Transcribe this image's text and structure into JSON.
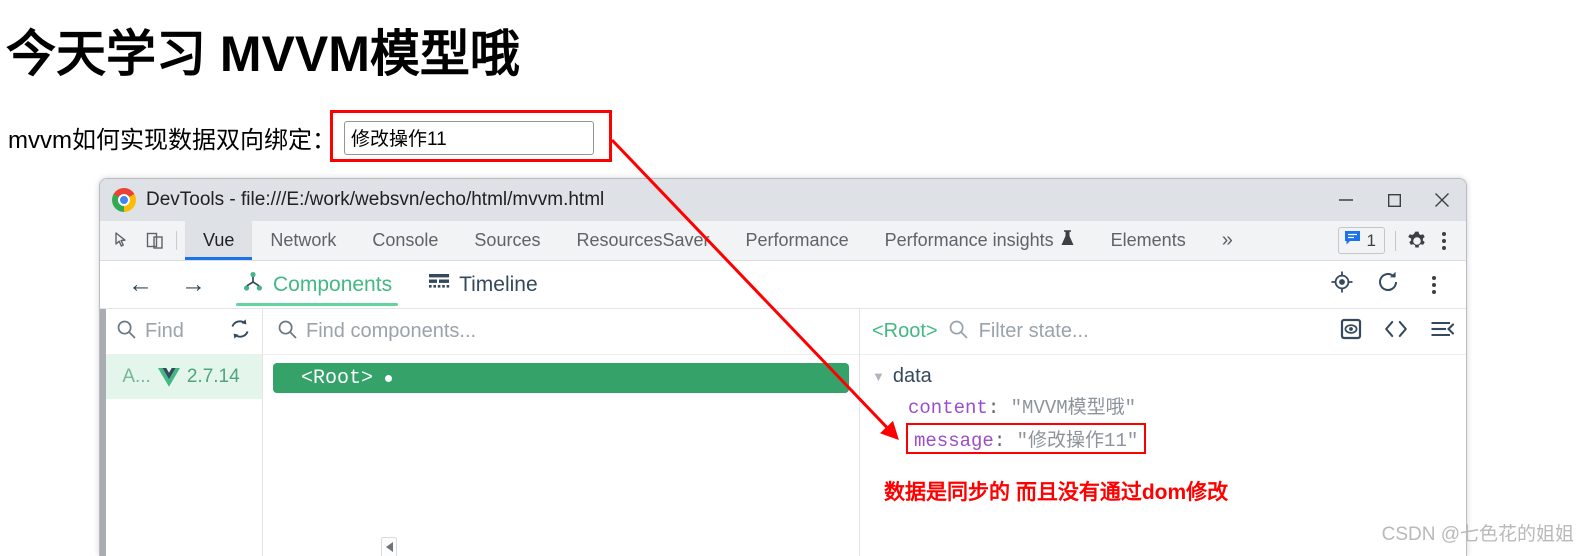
{
  "page": {
    "heading": "今天学习 MVVM模型哦",
    "binding_label": "mvvm如何实现数据双向绑定：",
    "input_value": "修改操作11",
    "input_placeholder": ""
  },
  "window": {
    "title": "DevTools - file:///E:/work/websvn/echo/html/mvvm.html",
    "minimize_label": "—",
    "maximize_label": "□",
    "close_label": "✕"
  },
  "devtools_tabs": {
    "items": [
      {
        "label": "Vue",
        "active": true
      },
      {
        "label": "Network",
        "active": false
      },
      {
        "label": "Console",
        "active": false
      },
      {
        "label": "Sources",
        "active": false
      },
      {
        "label": "ResourcesSaver",
        "active": false
      },
      {
        "label": "Performance",
        "active": false
      },
      {
        "label": "Performance insights",
        "active": false
      },
      {
        "label": "Elements",
        "active": false
      }
    ],
    "overflow_label": "»",
    "message_count": "1",
    "icons": {
      "inspect": "inspect-element-icon",
      "device": "device-toolbar-icon",
      "flask": "flask-icon",
      "message": "message-icon",
      "settings": "gear-icon",
      "more": "more-vertical-icon"
    }
  },
  "vue_toolbar": {
    "back": "←",
    "forward": "→",
    "tabs": [
      {
        "label": "Components",
        "active": true,
        "icon": "components-tree-icon"
      },
      {
        "label": "Timeline",
        "active": false,
        "icon": "timeline-bars-icon"
      }
    ],
    "right_icons": {
      "target": "select-component-target-icon",
      "refresh": "refresh-icon",
      "more": "more-vertical-icon"
    }
  },
  "apps_pane": {
    "search_placeholder": "Find",
    "sync_icon": "sync-refresh-icon",
    "app": {
      "name": "A...",
      "version": "2.7.14",
      "logo": "vue-logo-icon"
    }
  },
  "tree_pane": {
    "search_placeholder": "Find components...",
    "nodes": [
      {
        "label": "<Root>",
        "selected": true,
        "has_dot": true
      }
    ],
    "scroll_left_icon": "chevron-left-icon"
  },
  "state_pane": {
    "component_name": "<Root>",
    "filter_placeholder": "Filter state...",
    "icons": {
      "eye": "inspect-dom-icon",
      "code": "open-in-editor-icon",
      "collapse": "collapse-all-icon"
    },
    "group": {
      "label": "data",
      "expanded": true,
      "entries": [
        {
          "key": "content",
          "value": "\"MVVM模型哦\"",
          "highlighted": false
        },
        {
          "key": "message",
          "value": "\"修改操作11\"",
          "highlighted": true
        }
      ]
    },
    "annotation": "数据是同步的  而且没有通过dom修改"
  },
  "watermark": "CSDN @七色花的姐姐",
  "colors": {
    "vue_green": "#42b883",
    "selected_node_green": "#35a26a",
    "app_row_bg": "#e4f6ec",
    "annotation_red": "#ff0000",
    "chrome_blue": "#1a73e8",
    "key_purple": "#9b4dca"
  }
}
